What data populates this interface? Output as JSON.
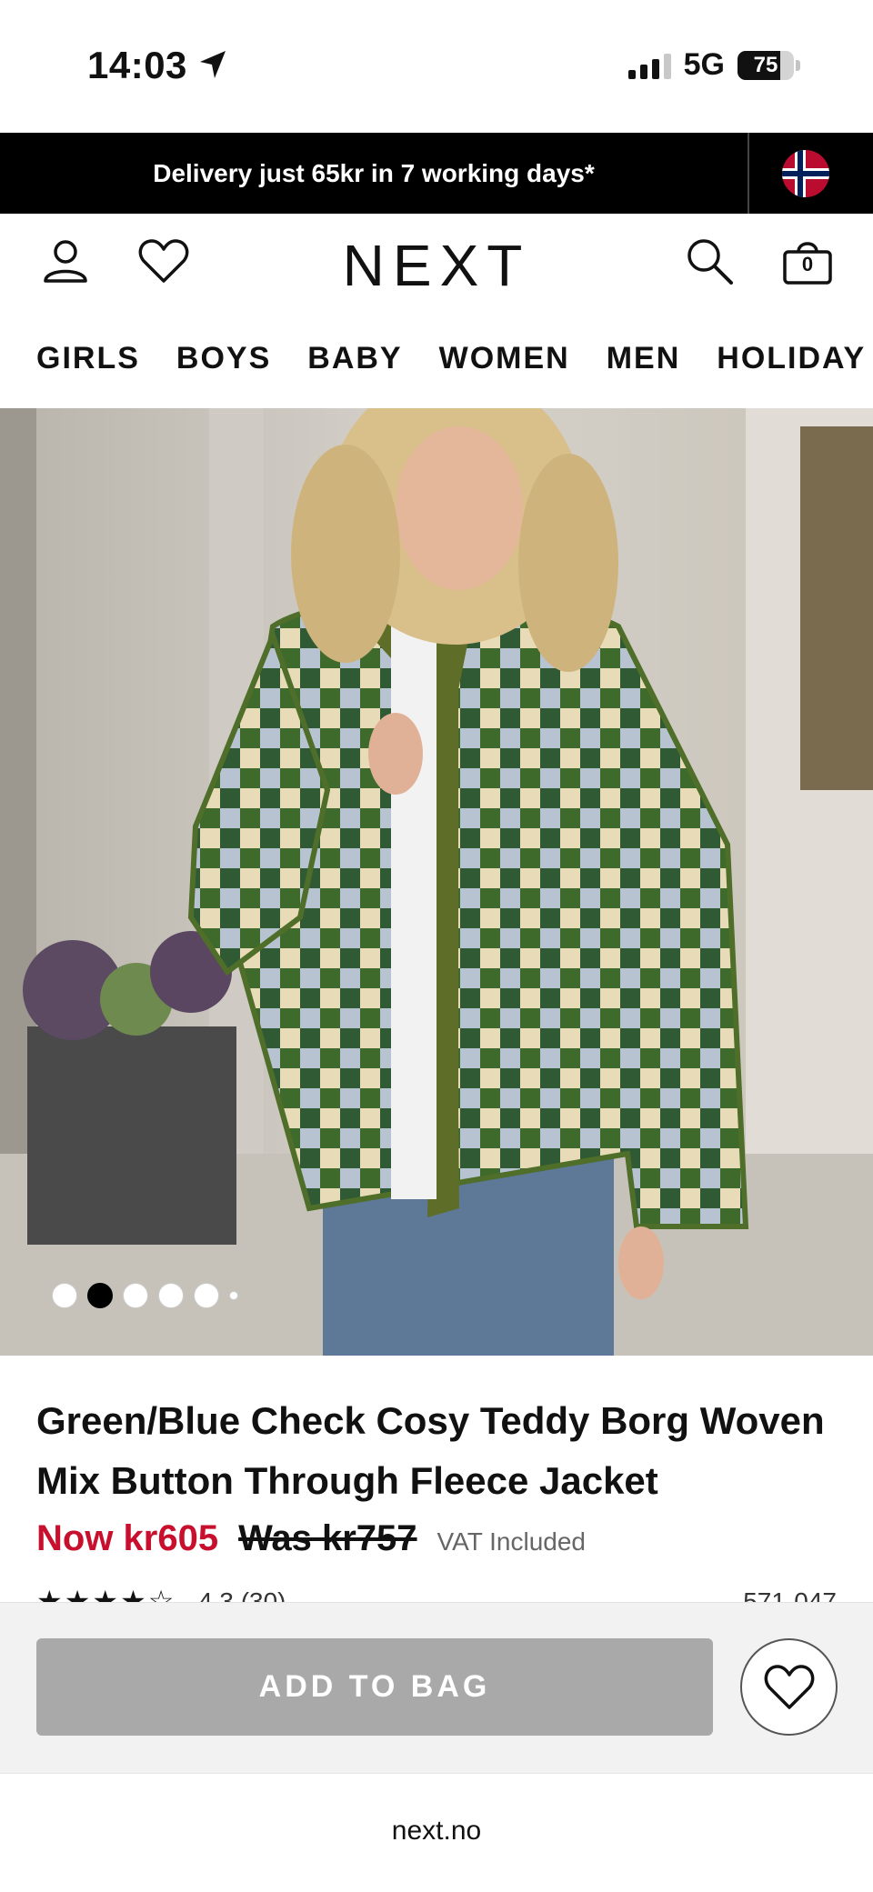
{
  "status_bar": {
    "time": "14:03",
    "network": "5G",
    "battery": "75",
    "battery_level": 0.75,
    "location_icon": "location-arrow-icon"
  },
  "delivery_banner": {
    "text": "Delivery just 65kr in 7 working days*",
    "flag_icon": "norway-flag-icon"
  },
  "header": {
    "logo": "NEXT",
    "bag_count": "0",
    "icons": [
      "account-icon",
      "wishlist-heart-icon",
      "search-icon",
      "shopping-bag-icon"
    ]
  },
  "nav": {
    "items": [
      "GIRLS",
      "BOYS",
      "BABY",
      "WOMEN",
      "MEN",
      "HOLIDAY"
    ]
  },
  "gallery": {
    "dot_count": 6,
    "active_index": 1
  },
  "product": {
    "title": "Green/Blue Check Cosy Teddy Borg Woven Mix Button Through Fleece Jacket",
    "price_now": "Now kr605",
    "price_was": "Was kr757",
    "vat": "VAT Included",
    "stars": "★★★★☆",
    "rating": "4.3 (30)",
    "sku": "571-047"
  },
  "actions": {
    "add_to_bag": "ADD TO BAG",
    "favourite_icon": "heart-icon"
  },
  "browser": {
    "url": "next.no"
  },
  "colors": {
    "sale_red": "#c8102e",
    "banner_black": "#000000",
    "button_grey": "#a9a9a9",
    "jacket_green": "#3f6b2e",
    "jacket_cream": "#e9dfc0",
    "jacket_blue": "#a9b8c9"
  }
}
